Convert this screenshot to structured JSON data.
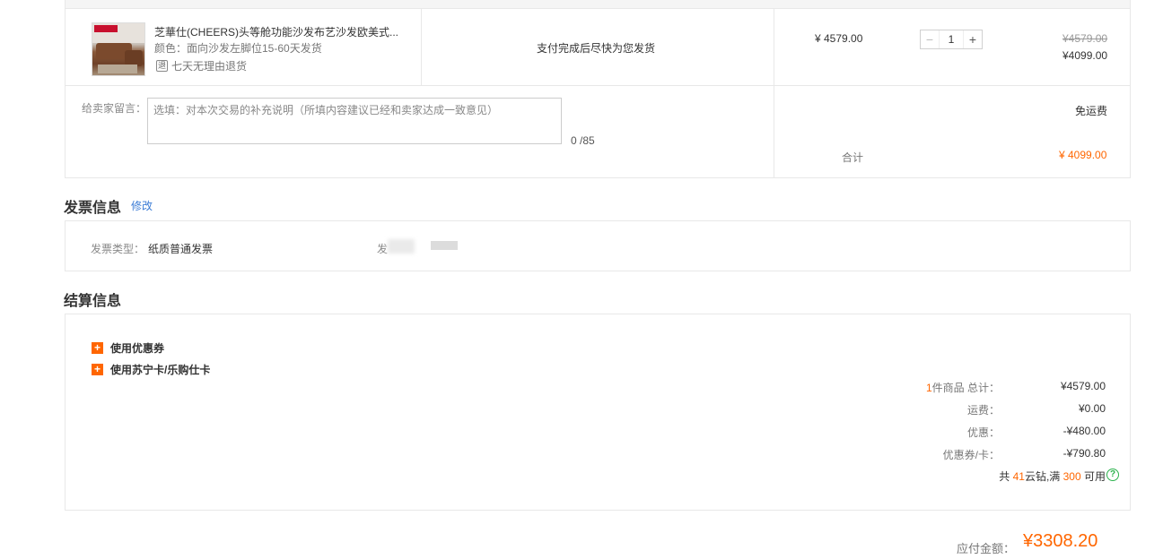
{
  "product": {
    "title": "芝華仕(CHEERS)头等舱功能沙发布艺沙发欧美式...",
    "color": "颜色：面向沙发左脚位15-60天发货",
    "return_icon": "退",
    "return_policy": "七天无理由退货",
    "ship_note": "支付完成后尽快为您发货",
    "unit_price": "¥ 4579.00",
    "quantity": "1",
    "qty_minus": "−",
    "qty_plus": "+",
    "original_price": "¥4579.00",
    "current_price": "¥4099.00"
  },
  "message": {
    "label": "给卖家留言：",
    "placeholder": "选填：对本次交易的补充说明（所填内容建议已经和卖家达成一致意见）",
    "count": "0 /85"
  },
  "shipping": {
    "free_label": "免运费",
    "subtotal_label": "合计",
    "subtotal_value": "¥ 4099.00"
  },
  "invoice": {
    "title": "发票信息",
    "edit": "修改",
    "type_label": "发票类型：",
    "type_value": "纸质普通发票",
    "head_label": "发"
  },
  "settlement": {
    "title": "结算信息",
    "coupon": "使用优惠券",
    "card": "使用苏宁卡/乐购仕卡",
    "items_count": "1",
    "items_label": "件商品 总计：",
    "items_total": "¥4579.00",
    "freight_label": "运费：",
    "freight_value": "¥0.00",
    "discount_label": "优惠：",
    "discount_value": "-¥480.00",
    "coupon_label": "优惠券/卡：",
    "coupon_value": "-¥790.80",
    "diamond_prefix": "共 ",
    "diamond_count": "41",
    "diamond_mid": "云钻,满 ",
    "diamond_threshold": "300",
    "diamond_suffix": " 可用",
    "help_icon": "?"
  },
  "payable": {
    "label": "应付金额：",
    "value": "¥3308.20"
  },
  "colors": {
    "accent": "#ff6600",
    "link": "#3a7bd5",
    "help": "#2bb24c"
  }
}
